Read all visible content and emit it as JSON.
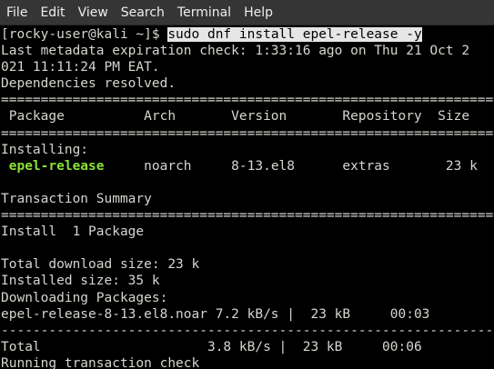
{
  "menu": {
    "file": "File",
    "edit": "Edit",
    "view": "View",
    "search": "Search",
    "terminal": "Terminal",
    "help": "Help"
  },
  "terminal": {
    "prompt": "[rocky-user@kali ~]$ ",
    "command": "sudo dnf install epel-release -y",
    "metadata_1": "Last metadata expiration check: 1:33:16 ago on Thu 21 Oct 2",
    "metadata_2": "021 11:11:24 PM EAT.",
    "deps": "Dependencies resolved.",
    "rule_eq": "================================================================================",
    "header": " Package          Arch       Version       Repository  Size",
    "installing": "Installing:",
    "pkg_lead": " ",
    "pkg_name": "epel-release",
    "pkg_rest": "     noarch     8-13.el8      extras       23 k",
    "blank": " ",
    "summary": "Transaction Summary",
    "install_count": "Install  1 Package",
    "download_size": "Total download size: 23 k",
    "installed_size": "Installed size: 35 k",
    "downloading": "Downloading Packages:",
    "download_row": "epel-release-8-13.el8.noar 7.2 kB/s |  23 kB     00:03",
    "rule_dash": "--------------------------------------------------------------------------------",
    "total_row": "Total                     3.8 kB/s |  23 kB     00:06",
    "running": "Running transaction check"
  }
}
